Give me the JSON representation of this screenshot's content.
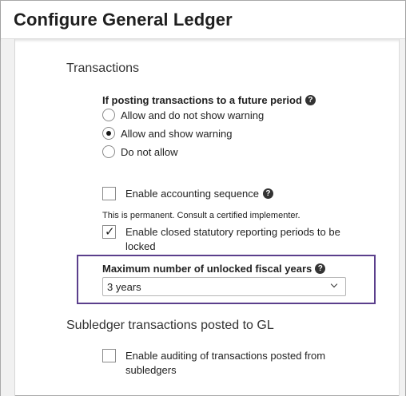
{
  "window": {
    "title": "Configure General Ledger"
  },
  "transactions": {
    "heading": "Transactions",
    "future_period": {
      "label": "If posting transactions to a future period",
      "options": [
        {
          "label": "Allow and do not show warning",
          "selected": false
        },
        {
          "label": "Allow and show warning",
          "selected": true
        },
        {
          "label": "Do not allow",
          "selected": false
        }
      ]
    },
    "accounting_sequence": {
      "label": "Enable accounting sequence",
      "checked": false
    },
    "permanent_note": "This is permanent. Consult a certified implementer.",
    "closed_periods": {
      "label": "Enable closed statutory reporting periods to be locked",
      "checked": true
    },
    "max_unlocked": {
      "label": "Maximum number of unlocked fiscal years",
      "value": "3 years"
    }
  },
  "subledger": {
    "heading": "Subledger transactions posted to GL",
    "auditing": {
      "label": "Enable auditing of transactions posted from subledgers",
      "checked": false
    }
  },
  "icons": {
    "help": "question-circle-icon",
    "check": "checkmark-icon",
    "dropdown": "chevron-down-icon"
  },
  "colors": {
    "highlight_border": "#5b3f8c"
  }
}
